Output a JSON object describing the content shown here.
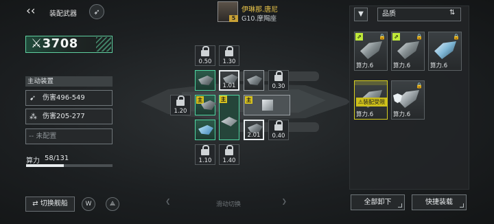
{
  "header": {
    "title": "装配武器",
    "pilot": {
      "name": "伊琳那.唐尼",
      "ship": "G10.摩羯座",
      "rank": "5"
    }
  },
  "power": {
    "value": "3708"
  },
  "active_device": {
    "heading": "主动装置",
    "items": [
      {
        "label": "伤害496-549",
        "icon": "gun-icon"
      },
      {
        "label": "伤害205-277",
        "icon": "scatter-icon"
      },
      {
        "label": "未配置",
        "icon": "dash-icon"
      }
    ]
  },
  "compute": {
    "label": "算力",
    "used": "58",
    "total": "/131",
    "fraction": 0.44
  },
  "bottom": {
    "switch_label": "切换舰船",
    "slide_hint": "滑动切换"
  },
  "slots": {
    "values": [
      "0.50",
      "1.30",
      "1.01",
      "0.30",
      "1.20",
      "2.01",
      "0.40",
      "1.10",
      "1.40"
    ],
    "main_tag": "主"
  },
  "right_panel": {
    "sort_label": "品质",
    "cards": [
      {
        "name": "算力.6",
        "badge": "⇗",
        "status": ""
      },
      {
        "name": "算力.6",
        "badge": "⇗",
        "status": ""
      },
      {
        "name": "算力.6",
        "badge": "",
        "status": ""
      },
      {
        "name": "算力.6",
        "badge": "",
        "status": "装配受限"
      },
      {
        "name": "算力.6",
        "badge": "",
        "status": ""
      }
    ],
    "unload_all": "全部卸下",
    "quick_equip": "快捷装载"
  }
}
